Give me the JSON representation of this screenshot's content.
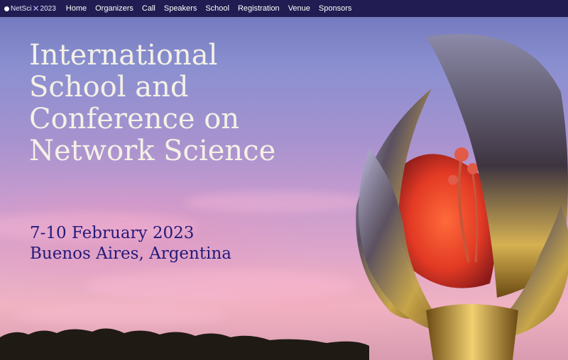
{
  "navbar": {
    "logo": {
      "brand": "NetSci",
      "year": "2023"
    },
    "items": [
      {
        "label": "Home"
      },
      {
        "label": "Organizers"
      },
      {
        "label": "Call"
      },
      {
        "label": "Speakers"
      },
      {
        "label": "School"
      },
      {
        "label": "Registration"
      },
      {
        "label": "Venue"
      },
      {
        "label": "Sponsors"
      }
    ]
  },
  "hero": {
    "title_lines": [
      "International",
      "School and",
      "Conference on",
      "Network Science"
    ],
    "date": "7-10 February 2023",
    "location": "Buenos Aires, Argentina",
    "image": "floralis-generica-sculpture-at-dusk"
  },
  "colors": {
    "navbar_bg": "#211d52",
    "title_color": "#f4f1e6",
    "subtitle_color": "#231a7a"
  }
}
